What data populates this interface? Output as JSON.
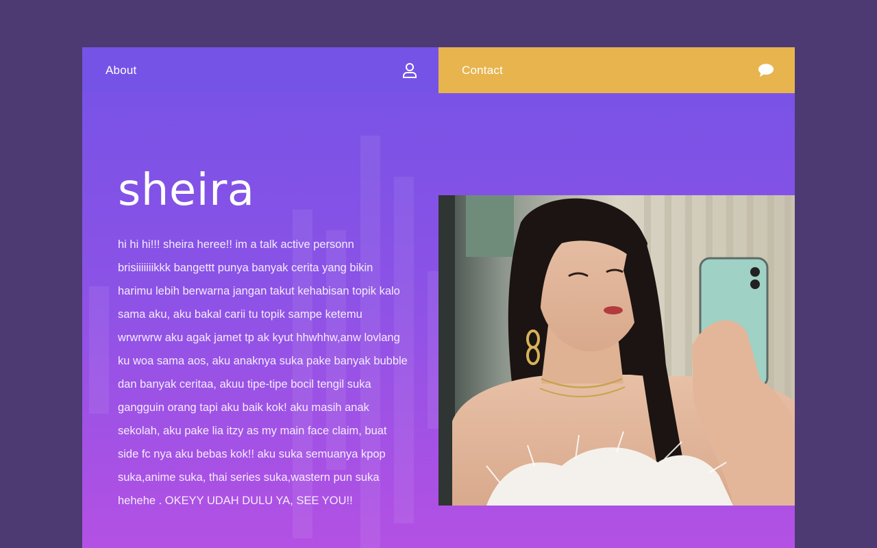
{
  "nav": {
    "about_label": "About",
    "about_icon": "user-icon",
    "contact_label": "Contact",
    "contact_icon": "chat-bubble-icon"
  },
  "profile": {
    "name": "sheira",
    "bio": "hi hi hi!!! sheira heree!! im a talk active personn brisiiiiiiikkk bangettt punya banyak cerita yang bikin harimu lebih berwarna jangan takut kehabisan topik kalo sama aku, aku bakal carii tu topik sampe ketemu wrwrwrw aku agak jamet tp ak kyut hhwhhw,anw lovlang ku woa sama aos, aku anaknya suka pake banyak bubble dan banyak ceritaa, akuu tipe-tipe bocil tengil suka gangguin orang tapi aku baik kok! aku masih anak sekolah, aku pake lia itzy as my main face claim, buat side fc nya aku bebas kok!! aku suka semuanya kpop suka,anime suka, thai series suka,wastern pun suka hehehe . OKEYY UDAH DULU YA, SEE YOU!!"
  },
  "colors": {
    "page_background": "#4d3a73",
    "card_gradient_top": "#7553e6",
    "card_gradient_bottom": "#b351e4",
    "contact_accent": "#e8b44e",
    "text": "#ffffff"
  }
}
